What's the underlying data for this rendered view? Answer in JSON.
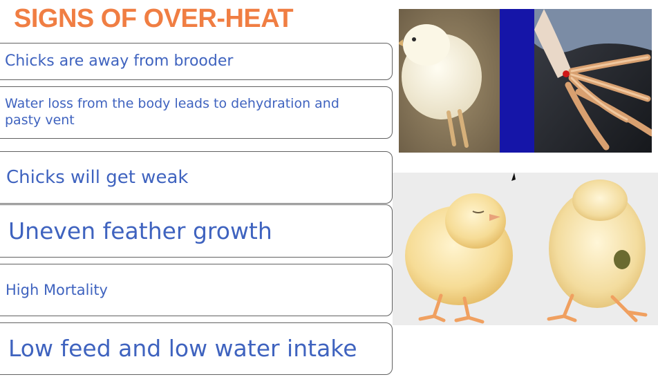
{
  "slide": {
    "title": "SIGNS OF OVER-HEAT",
    "title_color": "#f07e43",
    "text_color": "#3f63bf",
    "signs": [
      "Chicks are away from brooder",
      "Water loss from the body leads to dehydration and pasty vent",
      "Chicks will get weak",
      "Uneven feather growth",
      "High Mortality",
      "Low feed and low water intake"
    ]
  },
  "images": {
    "top": "chick-and-dehydrated-chicken-feet-photo",
    "bottom": "two-yellow-chicks-photo"
  }
}
